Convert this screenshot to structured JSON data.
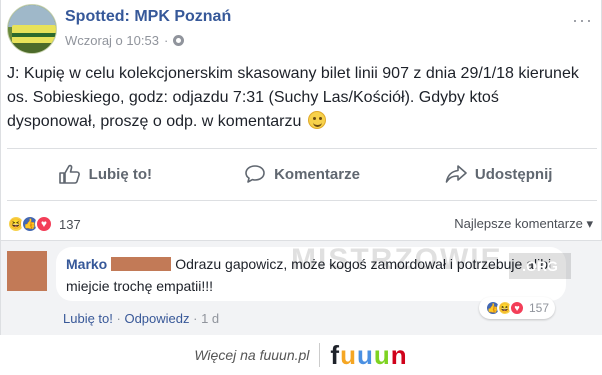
{
  "post": {
    "page_name": "Spotted: MPK Poznań",
    "timestamp": "Wczoraj o 10:53",
    "privacy_icon": "globe-icon",
    "options_icon": "more-options-icon",
    "text": "J: Kupię w celu kolekcjonerskim skasowany bilet linii 907 z dnia 29/1/18 kierunek os. Sobieskiego, godz: odjazdu 7:31 (Suchy Las/Kościół). Gdyby ktoś dysponował, proszę o odp. w komentarzu"
  },
  "actions": {
    "like": "Lubię to!",
    "comment": "Komentarze",
    "share": "Udostępnij"
  },
  "reactions": {
    "count": "137",
    "sort_label": "Najlepsze komentarze ▾"
  },
  "comment": {
    "author": "Marko",
    "text": "Odrazu gapowicz, może kogoś zamordował i potrzebuje alibi miejcie trochę empatii!!!",
    "like_link": "Lubię to!",
    "reply_link": "Odpowiedz",
    "age": "1 d",
    "reaction_count": "157"
  },
  "watermark": {
    "text": "MISTRZOWIE",
    "suffix": ".ORG"
  },
  "footer": {
    "text": "Więcej na fuuun.pl",
    "logo": "fuuun"
  },
  "colors": {
    "link_blue": "#365899",
    "like_blue": "#4267b2",
    "love_red": "#f33e58",
    "haha_yellow": "#f7d14a"
  }
}
